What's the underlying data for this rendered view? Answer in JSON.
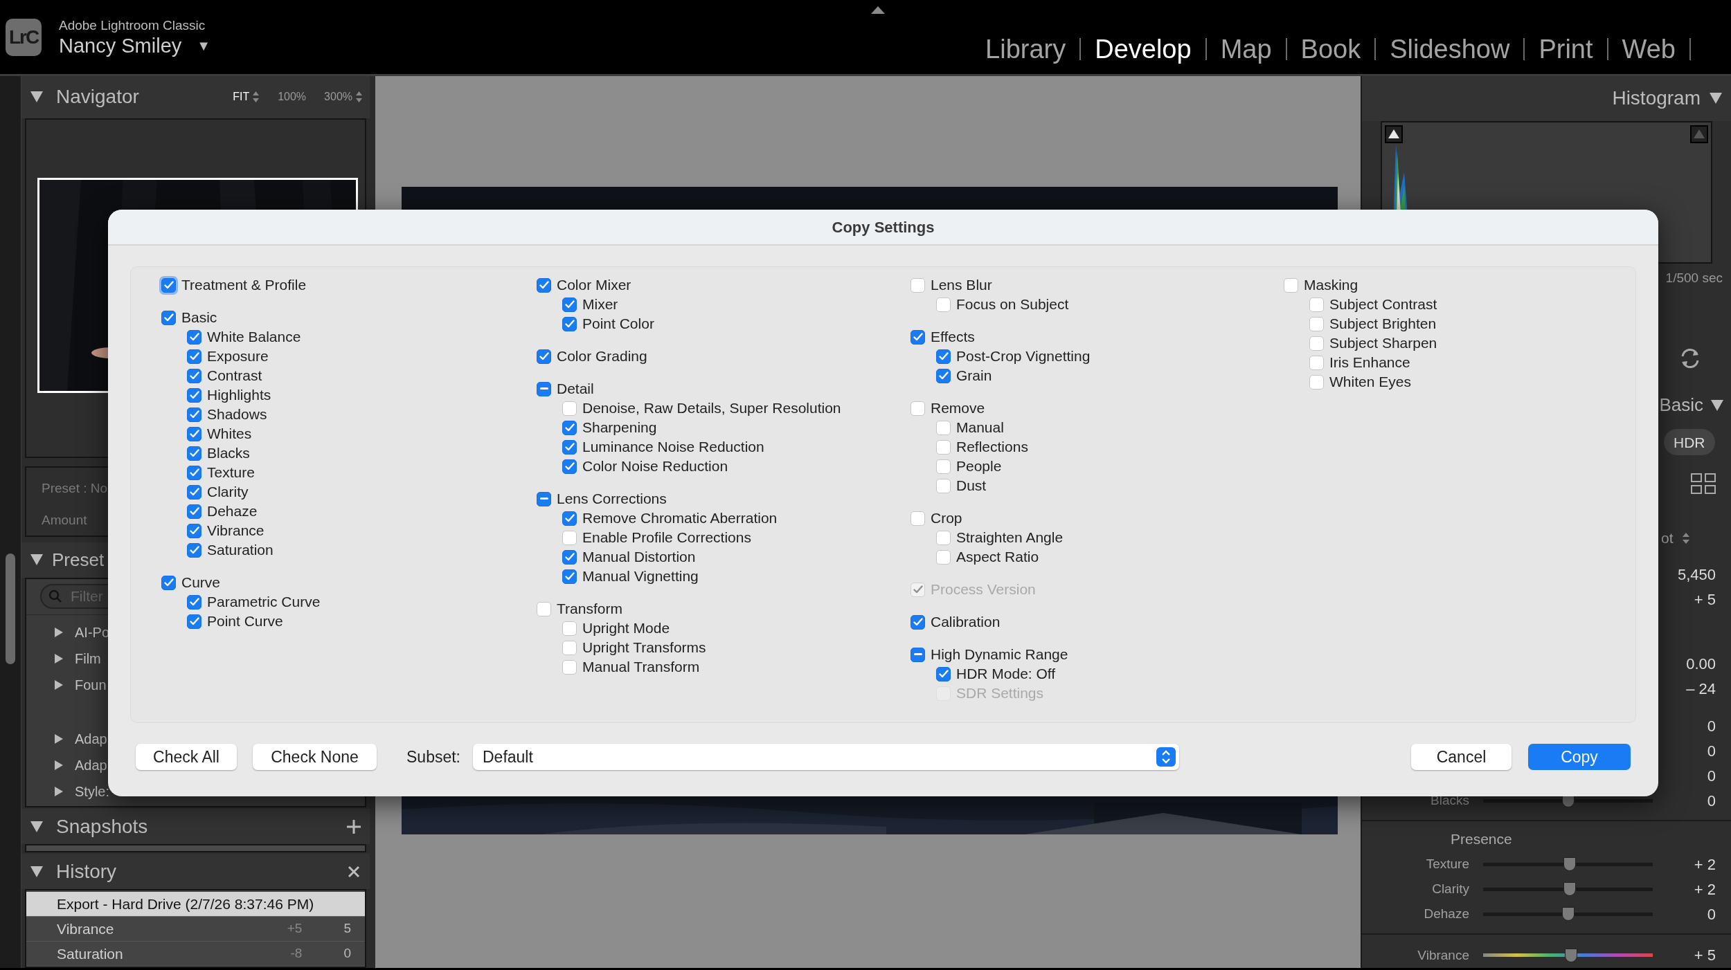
{
  "top_bar": {
    "logo": "LrC",
    "app_name": "Adobe Lightroom Classic",
    "user": "Nancy Smiley",
    "user_menu": "▼",
    "modules": [
      {
        "label": "Library",
        "selected": false
      },
      {
        "label": "Develop",
        "selected": true
      },
      {
        "label": "Map",
        "selected": false
      },
      {
        "label": "Book",
        "selected": false
      },
      {
        "label": "Slideshow",
        "selected": false
      },
      {
        "label": "Print",
        "selected": false
      },
      {
        "label": "Web",
        "selected": false
      }
    ]
  },
  "left_panel": {
    "navigator": {
      "title": "Navigator",
      "zoom_options": [
        {
          "label": "FIT",
          "selected": true
        },
        {
          "label": "100%",
          "selected": false
        },
        {
          "label": "300%",
          "selected": false
        }
      ]
    },
    "preset_amount": {
      "preset": "Preset : No",
      "amount": "Amount"
    },
    "presets": {
      "title": "Preset",
      "filter_placeholder": "Filter",
      "groups": [
        [
          {
            "label": "AI-Po"
          },
          {
            "label": "Film"
          },
          {
            "label": "Foun"
          }
        ],
        [
          {
            "label": "Adap"
          },
          {
            "label": "Adap"
          },
          {
            "label": "Style:"
          }
        ]
      ]
    },
    "snapshots": {
      "title": "Snapshots"
    },
    "history": {
      "title": "History",
      "rows": [
        {
          "label": "Export - Hard Drive (2/7/26 8:37:46 PM)",
          "selected": true
        },
        {
          "label": "Vibrance",
          "before": "+5",
          "after": "5",
          "selected": false
        },
        {
          "label": "Saturation",
          "before": "-8",
          "after": "0",
          "selected": false
        }
      ]
    }
  },
  "right_panel": {
    "histogram": {
      "title": "Histogram",
      "exposure": "1/500 sec"
    },
    "basic": {
      "title": "Basic",
      "hdr": "HDR",
      "profile": "ot",
      "values": [
        "5,450",
        "+ 5",
        "0.00",
        "– 24",
        "0",
        "0",
        "0"
      ],
      "sliders": [
        {
          "label": "Blacks",
          "value": "0",
          "level": 0.5
        }
      ]
    },
    "presence": {
      "title": "Presence",
      "sliders": [
        {
          "label": "Texture",
          "value": "+ 2",
          "level": 0.51
        },
        {
          "label": "Clarity",
          "value": "+ 2",
          "level": 0.51
        },
        {
          "label": "Dehaze",
          "value": "0",
          "level": 0.5
        }
      ]
    },
    "vibrance": {
      "label": "Vibrance",
      "value": "+ 5",
      "level": 0.52
    }
  },
  "dialog": {
    "title": "Copy Settings",
    "columns": [
      [
        {
          "label": "Treatment & Profile",
          "checked": true,
          "disabled": false,
          "focused": true
        },
        {
          "label": "Basic",
          "checked": true,
          "disabled": false,
          "focused": false,
          "children": [
            {
              "label": "White Balance",
              "checked": true,
              "disabled": false
            },
            {
              "label": "Exposure",
              "checked": true,
              "disabled": false
            },
            {
              "label": "Contrast",
              "checked": true,
              "disabled": false
            },
            {
              "label": "Highlights",
              "checked": true,
              "disabled": false
            },
            {
              "label": "Shadows",
              "checked": true,
              "disabled": false
            },
            {
              "label": "Whites",
              "checked": true,
              "disabled": false
            },
            {
              "label": "Blacks",
              "checked": true,
              "disabled": false
            },
            {
              "label": "Texture",
              "checked": true,
              "disabled": false
            },
            {
              "label": "Clarity",
              "checked": true,
              "disabled": false
            },
            {
              "label": "Dehaze",
              "checked": true,
              "disabled": false
            },
            {
              "label": "Vibrance",
              "checked": true,
              "disabled": false
            },
            {
              "label": "Saturation",
              "checked": true,
              "disabled": false
            }
          ]
        },
        {
          "label": "Curve",
          "checked": true,
          "disabled": false,
          "focused": false,
          "children": [
            {
              "label": "Parametric Curve",
              "checked": true,
              "disabled": false
            },
            {
              "label": "Point Curve",
              "checked": true,
              "disabled": false
            }
          ]
        }
      ],
      [
        {
          "label": "Color Mixer",
          "checked": true,
          "disabled": false,
          "focused": false,
          "children": [
            {
              "label": "Mixer",
              "checked": true,
              "disabled": false
            },
            {
              "label": "Point Color",
              "checked": true,
              "disabled": false
            }
          ]
        },
        {
          "label": "Color Grading",
          "checked": true,
          "disabled": false,
          "focused": false
        },
        {
          "label": "Detail",
          "mixed": true,
          "disabled": false,
          "focused": false,
          "children": [
            {
              "label": "Denoise, Raw Details, Super Resolution",
              "checked": false,
              "disabled": false
            },
            {
              "label": "Sharpening",
              "checked": true,
              "disabled": false
            },
            {
              "label": "Luminance Noise Reduction",
              "checked": true,
              "disabled": false
            },
            {
              "label": "Color Noise Reduction",
              "checked": true,
              "disabled": false
            }
          ]
        },
        {
          "label": "Lens Corrections",
          "mixed": true,
          "disabled": false,
          "focused": false,
          "children": [
            {
              "label": "Remove Chromatic Aberration",
              "checked": true,
              "disabled": false
            },
            {
              "label": "Enable Profile Corrections",
              "checked": false,
              "disabled": false
            },
            {
              "label": "Manual Distortion",
              "checked": true,
              "disabled": false
            },
            {
              "label": "Manual Vignetting",
              "checked": true,
              "disabled": false
            }
          ]
        },
        {
          "label": "Transform",
          "checked": false,
          "disabled": false,
          "focused": false,
          "children": [
            {
              "label": "Upright Mode",
              "checked": false,
              "disabled": false
            },
            {
              "label": "Upright Transforms",
              "checked": false,
              "disabled": false
            },
            {
              "label": "Manual Transform",
              "checked": false,
              "disabled": false
            }
          ]
        }
      ],
      [
        {
          "label": "Lens Blur",
          "checked": false,
          "disabled": false,
          "focused": false,
          "children": [
            {
              "label": "Focus on Subject",
              "checked": false,
              "disabled": false
            }
          ]
        },
        {
          "label": "Effects",
          "checked": true,
          "disabled": false,
          "focused": false,
          "children": [
            {
              "label": "Post-Crop Vignetting",
              "checked": true,
              "disabled": false
            },
            {
              "label": "Grain",
              "checked": true,
              "disabled": false
            }
          ]
        },
        {
          "label": "Remove",
          "checked": false,
          "disabled": false,
          "focused": false,
          "children": [
            {
              "label": "Manual",
              "checked": false,
              "disabled": false
            },
            {
              "label": "Reflections",
              "checked": false,
              "disabled": false
            },
            {
              "label": "People",
              "checked": false,
              "disabled": false
            },
            {
              "label": "Dust",
              "checked": false,
              "disabled": false
            }
          ]
        },
        {
          "label": "Crop",
          "checked": false,
          "disabled": false,
          "focused": false,
          "children": [
            {
              "label": "Straighten Angle",
              "checked": false,
              "disabled": false
            },
            {
              "label": "Aspect Ratio",
              "checked": false,
              "disabled": false
            }
          ]
        },
        {
          "label": "Process Version",
          "checked": true,
          "disabled": true,
          "focused": false
        },
        {
          "label": "Calibration",
          "checked": true,
          "disabled": false,
          "focused": false
        },
        {
          "label": "High Dynamic Range",
          "mixed": true,
          "disabled": false,
          "focused": false,
          "children": [
            {
              "label": "HDR Mode: Off",
              "checked": true,
              "disabled": false
            },
            {
              "label": "SDR Settings",
              "checked": false,
              "disabled": true
            }
          ]
        }
      ],
      [
        {
          "label": "Masking",
          "checked": false,
          "disabled": false,
          "focused": false,
          "children": [
            {
              "label": "Subject Contrast",
              "checked": false,
              "disabled": false
            },
            {
              "label": "Subject Brighten",
              "checked": false,
              "disabled": false
            },
            {
              "label": "Subject Sharpen",
              "checked": false,
              "disabled": false
            },
            {
              "label": "Iris Enhance",
              "checked": false,
              "disabled": false
            },
            {
              "label": "Whiten Eyes",
              "checked": false,
              "disabled": false
            }
          ]
        }
      ]
    ],
    "check_all": "Check All",
    "check_none": "Check None",
    "subset_label": "Subset:",
    "subset_value": "Default",
    "cancel": "Cancel",
    "copy": "Copy"
  }
}
